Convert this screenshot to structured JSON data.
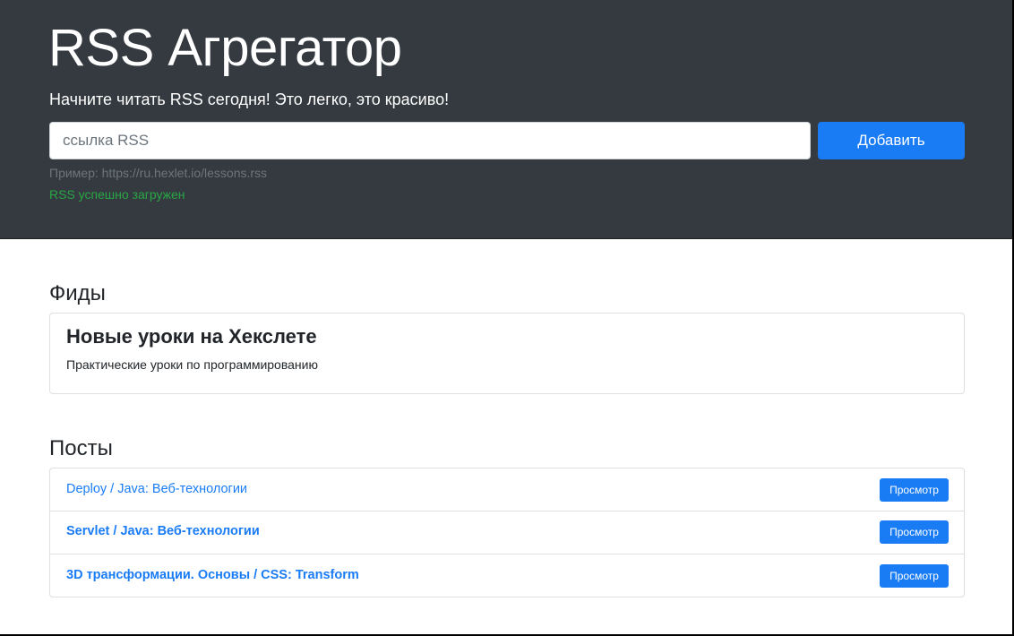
{
  "header": {
    "title": "RSS Агрегатор",
    "lead": "Начните читать RSS сегодня! Это легко, это красиво!",
    "input_placeholder": "ссылка RSS",
    "add_button_label": "Добавить",
    "example": "Пример: https://ru.hexlet.io/lessons.rss",
    "feedback": "RSS успешно загружен"
  },
  "feeds": {
    "title": "Фиды",
    "items": [
      {
        "title": "Новые уроки на Хекслете",
        "description": "Практические уроки по программированию"
      }
    ]
  },
  "posts": {
    "title": "Посты",
    "items": [
      {
        "title": "Deploy / Java: Веб-технологии",
        "button": "Просмотр",
        "read": true
      },
      {
        "title": "Servlet / Java: Веб-технологии",
        "button": "Просмотр",
        "read": false
      },
      {
        "title": "3D трансформации. Основы / CSS: Transform",
        "button": "Просмотр",
        "read": false
      }
    ]
  },
  "colors": {
    "hero_background": "#343a40",
    "primary": "#1a7cf5",
    "success": "#28a745",
    "muted": "#6c757d"
  }
}
